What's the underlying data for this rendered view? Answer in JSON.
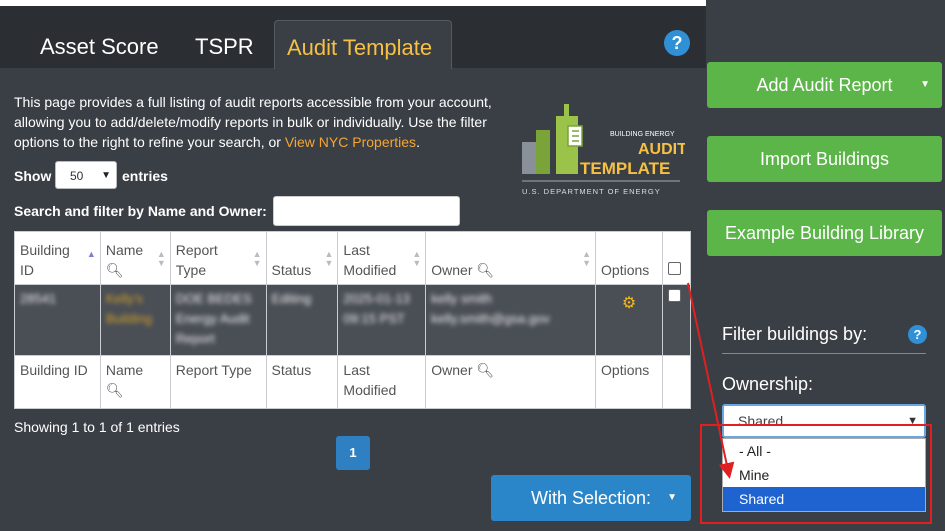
{
  "tabs": [
    {
      "label": "Asset Score"
    },
    {
      "label": "TSPR"
    },
    {
      "label": "Audit Template"
    }
  ],
  "help_icon": "question-circle-icon",
  "intro": {
    "text": "This page provides a full listing of audit reports accessible from your account, allowing you to add/delete/modify reports in bulk or individually. Use the filter options to the right to refine your search, or ",
    "link": "View NYC Properties",
    "suffix": "."
  },
  "logo": {
    "line1": "BUILDING ENERGY",
    "line2": "AUDIT",
    "line3": "TEMPLATE",
    "line4": "U.S. DEPARTMENT OF ENERGY"
  },
  "entries": {
    "show_label": "Show",
    "value": "50",
    "suffix": "entries"
  },
  "search": {
    "label": "Search and filter by Name and Owner:",
    "value": ""
  },
  "table": {
    "headers": [
      {
        "l1": "Building",
        "l2": "ID"
      },
      {
        "l1": "Name",
        "l2": ""
      },
      {
        "l1": "Report",
        "l2": "Type"
      },
      {
        "l1": "",
        "l2": "Status"
      },
      {
        "l1": "Last",
        "l2": "Modified"
      },
      {
        "l1": "",
        "l2": "Owner"
      },
      {
        "l1": "",
        "l2": "Options"
      }
    ],
    "row": {
      "id": "28541",
      "name": "Kelly's Building",
      "report_type": "DOE BEDES Energy Audit Report",
      "status": "Editing",
      "modified": "2025-01-13 09:15 PST",
      "owner": "kelly smith kelly.smith@gsa.gov"
    },
    "footer": [
      {
        "l1": "Building ID",
        "l2": ""
      },
      {
        "l1": "Name",
        "l2": ""
      },
      {
        "l1": "Report Type",
        "l2": ""
      },
      {
        "l1": "Status",
        "l2": ""
      },
      {
        "l1": "Last",
        "l2": "Modified"
      },
      {
        "l1": "Owner",
        "l2": ""
      },
      {
        "l1": "Options",
        "l2": ""
      }
    ]
  },
  "showing": "Showing 1 to 1 of 1 entries",
  "pagination": {
    "current": "1"
  },
  "with_selection": "With Selection:",
  "sidebar": {
    "add_audit": "Add Audit Report",
    "import": "Import Buildings",
    "example": "Example Building Library",
    "filter_label": "Filter buildings by:",
    "ownership_label": "Ownership:",
    "ownership_value": "Shared",
    "options": [
      "- All -",
      "Mine",
      "Shared"
    ]
  },
  "colors": {
    "accent": "#f6c142",
    "green": "#5cb548",
    "blue": "#2b86c9",
    "annotation": "#e02020"
  }
}
